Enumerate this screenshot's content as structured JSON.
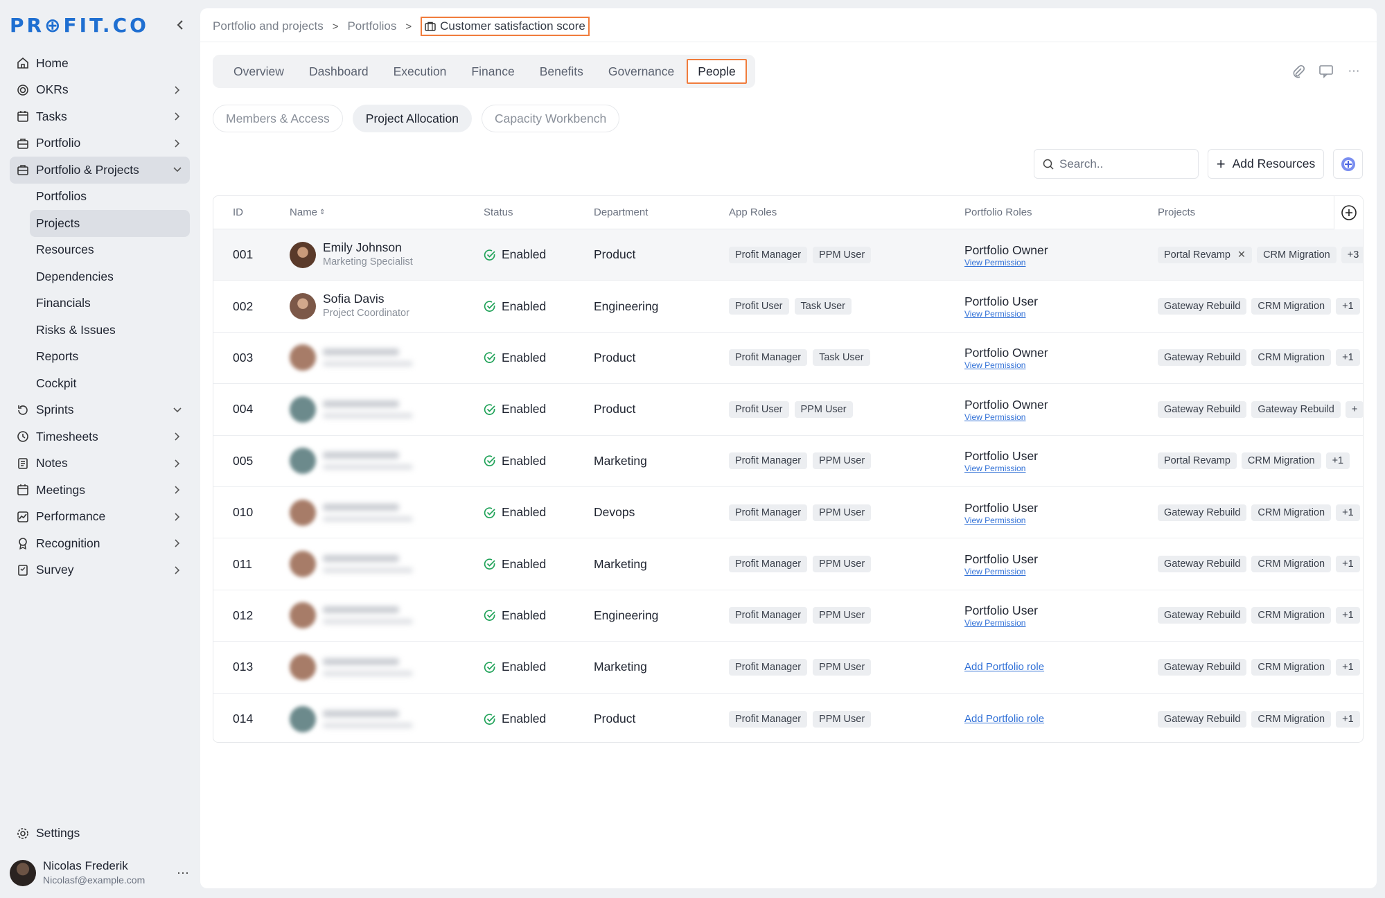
{
  "logo": "PR⊕FIT.CO",
  "sidebar": {
    "items": [
      {
        "label": "Home",
        "chevron": ""
      },
      {
        "label": "OKRs",
        "chevron": ">"
      },
      {
        "label": "Tasks",
        "chevron": ">"
      },
      {
        "label": "Portfolio",
        "chevron": ">"
      },
      {
        "label": "Portfolio & Projects",
        "chevron": "v"
      }
    ],
    "sub_items": [
      "Portfolios",
      "Projects",
      "Resources",
      "Dependencies",
      "Financials",
      "Risks & Issues",
      "Reports",
      "Cockpit"
    ],
    "items2": [
      {
        "label": "Sprints",
        "chevron": "v"
      },
      {
        "label": "Timesheets",
        "chevron": ">"
      },
      {
        "label": "Notes",
        "chevron": ">"
      },
      {
        "label": "Meetings",
        "chevron": ">"
      },
      {
        "label": "Performance",
        "chevron": ">"
      },
      {
        "label": "Recognition",
        "chevron": ">"
      },
      {
        "label": "Survey",
        "chevron": ">"
      }
    ],
    "settings": "Settings",
    "user": {
      "name": "Nicolas Frederik",
      "email": "Nicolasf@example.com"
    }
  },
  "breadcrumb": {
    "items": [
      "Portfolio and projects",
      "Portfolios"
    ],
    "current": "Customer satisfaction score"
  },
  "tabs": [
    "Overview",
    "Dashboard",
    "Execution",
    "Finance",
    "Benefits",
    "Governance",
    "People"
  ],
  "active_tab": "People",
  "subtabs": [
    "Members & Access",
    "Project Allocation",
    "Capacity Workbench"
  ],
  "active_subtab": "Project Allocation",
  "search": {
    "placeholder": "Search.."
  },
  "add_button": "Add Resources",
  "table": {
    "headers": {
      "id": "ID",
      "name": "Name",
      "status": "Status",
      "department": "Department",
      "app_roles": "App Roles",
      "portfolio_roles": "Portfolio Roles",
      "projects": "Projects"
    },
    "rows": [
      {
        "id": "001",
        "name": "Emily Johnson",
        "role": "Marketing Specialist",
        "status": "Enabled",
        "department": "Product",
        "app_roles": [
          "Profit Manager",
          "PPM User"
        ],
        "portfolio_role": "Portfolio Owner",
        "permission": "View Permission",
        "projects": [
          "Portal Revamp",
          "CRM Migration",
          "+3"
        ]
      },
      {
        "id": "002",
        "name": "Sofia Davis",
        "role": "Project Coordinator",
        "status": "Enabled",
        "department": "Engineering",
        "app_roles": [
          "Profit User",
          "Task User"
        ],
        "portfolio_role": "Portfolio User",
        "permission": "View Permission",
        "projects": [
          "Gateway Rebuild",
          "CRM Migration",
          "+1"
        ]
      },
      {
        "id": "003",
        "name": "",
        "role": "",
        "status": "Enabled",
        "department": "Product",
        "app_roles": [
          "Profit Manager",
          "Task User"
        ],
        "portfolio_role": "Portfolio Owner",
        "permission": "View Permission",
        "projects": [
          "Gateway Rebuild",
          "CRM Migration",
          "+1"
        ]
      },
      {
        "id": "004",
        "name": "",
        "role": "",
        "status": "Enabled",
        "department": "Product",
        "app_roles": [
          "Profit User",
          "PPM User"
        ],
        "portfolio_role": "Portfolio Owner",
        "permission": "View Permission",
        "projects": [
          "Gateway Rebuild",
          "Gateway Rebuild",
          "+"
        ]
      },
      {
        "id": "005",
        "name": "",
        "role": "",
        "status": "Enabled",
        "department": "Marketing",
        "app_roles": [
          "Profit Manager",
          "PPM User"
        ],
        "portfolio_role": "Portfolio User",
        "permission": "View Permission",
        "projects": [
          "Portal Revamp",
          "CRM Migration",
          "+1"
        ]
      },
      {
        "id": "010",
        "name": "",
        "role": "",
        "status": "Enabled",
        "department": "Devops",
        "app_roles": [
          "Profit Manager",
          "PPM User"
        ],
        "portfolio_role": "Portfolio User",
        "permission": "View Permission",
        "projects": [
          "Gateway Rebuild",
          "CRM Migration",
          "+1"
        ]
      },
      {
        "id": "011",
        "name": "",
        "role": "",
        "status": "Enabled",
        "department": "Marketing",
        "app_roles": [
          "Profit Manager",
          "PPM User"
        ],
        "portfolio_role": "Portfolio User",
        "permission": "View Permission",
        "projects": [
          "Gateway Rebuild",
          "CRM Migration",
          "+1"
        ]
      },
      {
        "id": "012",
        "name": "",
        "role": "",
        "status": "Enabled",
        "department": "Engineering",
        "app_roles": [
          "Profit Manager",
          "PPM User"
        ],
        "portfolio_role": "Portfolio User",
        "permission": "View Permission",
        "projects": [
          "Gateway Rebuild",
          "CRM Migration",
          "+1"
        ]
      },
      {
        "id": "013",
        "name": "",
        "role": "",
        "status": "Enabled",
        "department": "Marketing",
        "app_roles": [
          "Profit Manager",
          "PPM User"
        ],
        "portfolio_role": "",
        "add_role": "Add Portfolio role",
        "projects": [
          "Gateway Rebuild",
          "CRM Migration",
          "+1"
        ]
      },
      {
        "id": "014",
        "name": "",
        "role": "",
        "status": "Enabled",
        "department": "Product",
        "app_roles": [
          "Profit Manager",
          "PPM User"
        ],
        "portfolio_role": "",
        "add_role": "Add Portfolio role",
        "projects": [
          "Gateway Rebuild",
          "CRM Migration",
          "+1"
        ]
      }
    ]
  },
  "colors": {
    "accent": "#1f6fd1",
    "highlight": "#f07c3c",
    "success": "#22a35a",
    "link": "#2f6fd6"
  }
}
